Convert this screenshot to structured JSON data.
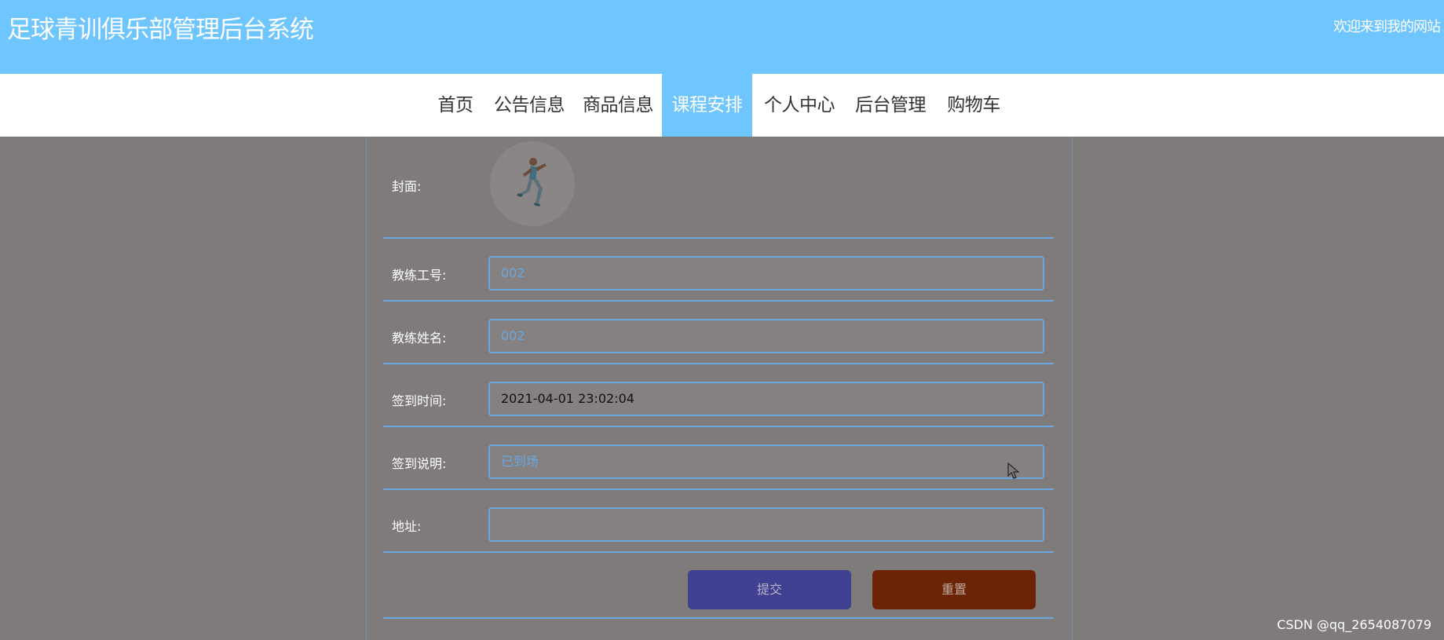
{
  "header": {
    "title": "足球青训俱乐部管理后台系统",
    "welcome": "欢迎来到我的网站"
  },
  "nav": {
    "items": [
      {
        "label": "首页"
      },
      {
        "label": "公告信息"
      },
      {
        "label": "商品信息"
      },
      {
        "label": "课程安排",
        "active": true
      },
      {
        "label": "个人中心"
      },
      {
        "label": "后台管理"
      },
      {
        "label": "购物车"
      }
    ]
  },
  "form": {
    "cover_label": "封面:",
    "coach_id_label": "教练工号:",
    "coach_id_value": "002",
    "coach_name_label": "教练姓名:",
    "coach_name_value": "002",
    "checkin_time_label": "签到时间:",
    "checkin_time_value": "2021-04-01 23:02:04",
    "checkin_note_label": "签到说明:",
    "checkin_note_value": "已到场",
    "address_label": "地址:",
    "address_value": "",
    "submit_label": "提交",
    "reset_label": "重置"
  },
  "watermark": "CSDN @qq_2654087079",
  "colors": {
    "header_bg": "#6fc6ff",
    "overlay": "#7f7b7b",
    "field_border": "#6aa6e0",
    "submit_bg": "#3f4091",
    "reset_bg": "#6b2306"
  }
}
